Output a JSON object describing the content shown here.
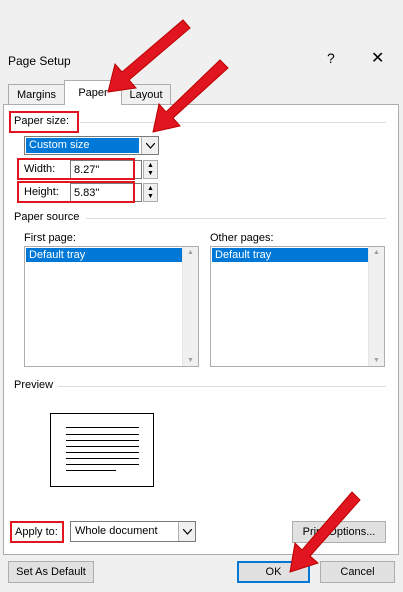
{
  "dialog": {
    "title": "Page Setup",
    "help": "?",
    "close": "✕"
  },
  "tabs": [
    {
      "label": "Margins"
    },
    {
      "label": "Paper"
    },
    {
      "label": "Layout"
    }
  ],
  "paper_size": {
    "label": "Paper size:",
    "selected": "Custom size"
  },
  "width": {
    "label": "Width:",
    "value": "8.27\""
  },
  "height": {
    "label": "Height:",
    "value": "5.83\""
  },
  "paper_source": {
    "label": "Paper source",
    "first_page": {
      "label": "First page:",
      "selected": "Default tray"
    },
    "other_pages": {
      "label": "Other pages:",
      "selected": "Default tray"
    }
  },
  "preview": {
    "label": "Preview"
  },
  "apply_to": {
    "label": "Apply to:",
    "selected": "Whole document"
  },
  "buttons": {
    "print_options": "Print Options...",
    "set_default": "Set As Default",
    "ok": "OK",
    "cancel": "Cancel"
  },
  "colors": {
    "highlight": "#e0151f",
    "selection": "#0078d7"
  }
}
